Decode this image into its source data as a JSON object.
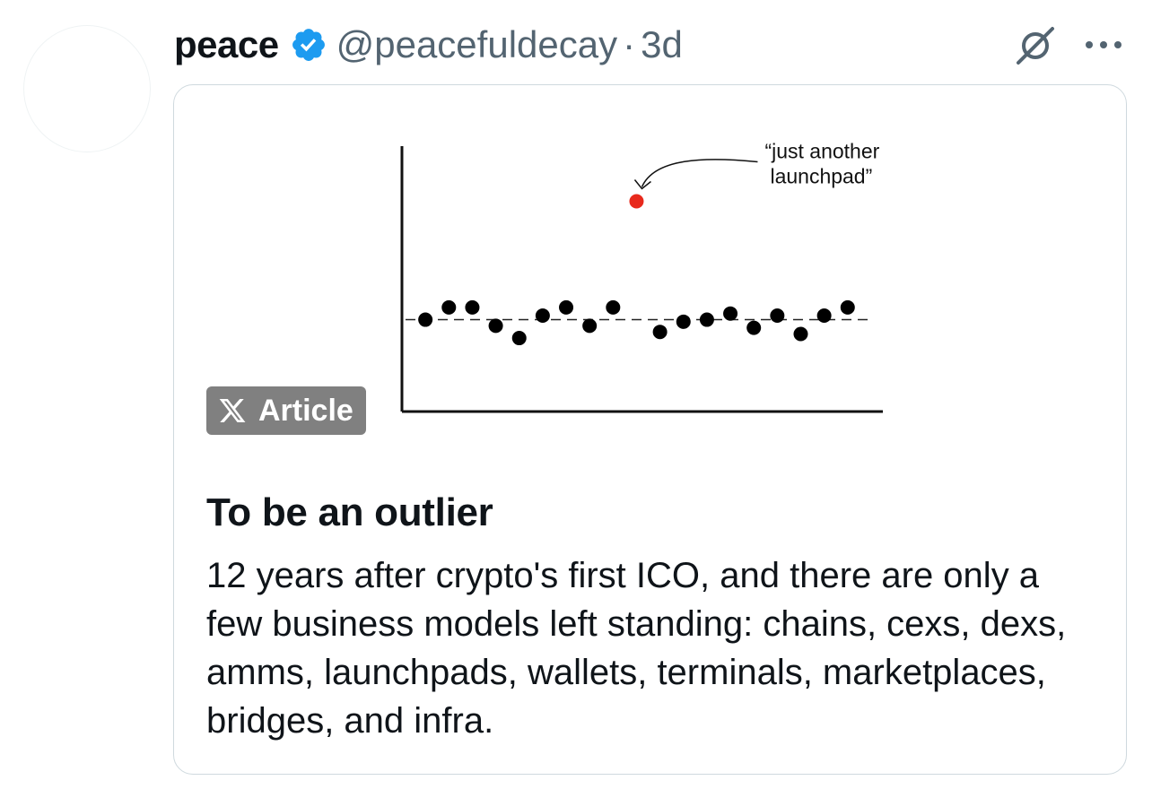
{
  "tweet": {
    "display_name": "peace",
    "verified": true,
    "handle": "@peacefuldecay",
    "separator": "·",
    "timestamp": "3d"
  },
  "icons": {
    "verified": "verified-badge-icon",
    "grok": "grok-icon",
    "more": "more-options-icon",
    "x_logo": "x-logo-icon"
  },
  "colors": {
    "verified_blue": "#1d9bf0",
    "outlier_red": "#e8291c",
    "badge_gray": "#808080",
    "muted_text": "#536471"
  },
  "card": {
    "badge_label": "Article",
    "title": "To be an outlier",
    "body": "12 years after crypto's first ICO, and there are only a few business models left standing: chains, cexs, dexs, amms, launchpads, wallets, terminals, marketplaces, bridges, and infra."
  },
  "chart_data": {
    "type": "scatter",
    "title": "",
    "xlabel": "",
    "ylabel": "",
    "grid": false,
    "reference_line": {
      "style": "dashed",
      "y": 0
    },
    "xlim": [
      0,
      20.5
    ],
    "ylim": [
      -4.5,
      8.5
    ],
    "series": [
      {
        "color": "#000000",
        "points": [
          {
            "x": 1,
            "y": 0
          },
          {
            "x": 2,
            "y": 0.6
          },
          {
            "x": 3,
            "y": 0.6
          },
          {
            "x": 4,
            "y": -0.3
          },
          {
            "x": 5,
            "y": -0.9
          },
          {
            "x": 6,
            "y": 0.2
          },
          {
            "x": 7,
            "y": 0.6
          },
          {
            "x": 8,
            "y": -0.3
          },
          {
            "x": 9,
            "y": 0.6
          },
          {
            "x": 11,
            "y": -0.6
          },
          {
            "x": 12,
            "y": -0.1
          },
          {
            "x": 13,
            "y": 0
          },
          {
            "x": 14,
            "y": 0.3
          },
          {
            "x": 15,
            "y": -0.4
          },
          {
            "x": 16,
            "y": 0.2
          },
          {
            "x": 17,
            "y": -0.7
          },
          {
            "x": 18,
            "y": 0.2
          },
          {
            "x": 19,
            "y": 0.6
          }
        ]
      },
      {
        "color": "#e8291c",
        "points": [
          {
            "x": 10,
            "y": 5.8
          }
        ]
      }
    ],
    "annotations": [
      {
        "text_lines": [
          "“just another",
          "launchpad”"
        ],
        "target": {
          "x": 10,
          "y": 5.8
        }
      }
    ]
  }
}
